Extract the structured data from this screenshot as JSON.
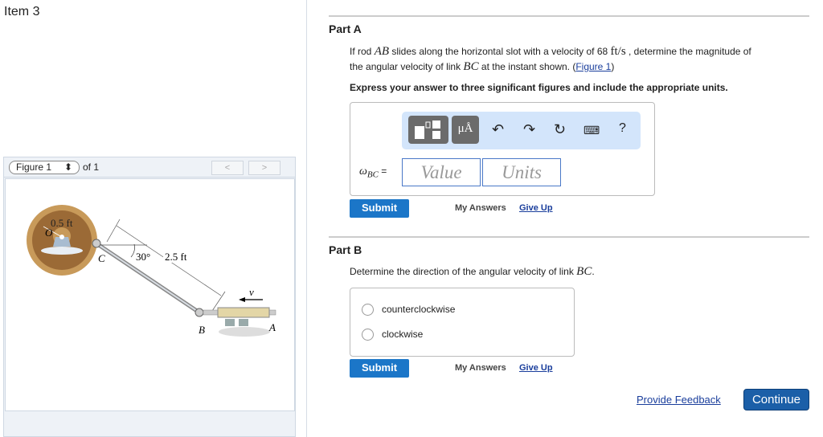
{
  "item_title": "Item 3",
  "figure": {
    "selector": "Figure 1",
    "of": "of 1",
    "prev": "<",
    "next": ">",
    "labels": {
      "radius": "0.5 ft",
      "O": "O",
      "C": "C",
      "angle": "30°",
      "length": "2.5 ft",
      "v": "v",
      "B": "B",
      "A": "A"
    }
  },
  "part_a": {
    "title": "Part A",
    "q1": "If rod ",
    "ab": "AB",
    "q2": " slides along the horizontal slot with a velocity of 68 ",
    "unit": "ft/s",
    "q3": " , determine the magnitude of",
    "q4": "the angular velocity of link ",
    "bc": "BC",
    "q5": " at the instant shown. (",
    "fig_link": "Figure 1",
    "q6": ")",
    "instruction": "Express your answer to three significant figures and include the appropriate units.",
    "toolbar": {
      "units_btn": "μÅ",
      "help": "?"
    },
    "var_label": "ω",
    "var_sub": "BC",
    "eq": " =",
    "value_placeholder": "Value",
    "units_placeholder": "Units",
    "submit": "Submit",
    "my_answers": "My Answers",
    "give_up": "Give Up"
  },
  "part_b": {
    "title": "Part B",
    "q1": "Determine the direction of the angular velocity of link ",
    "bc": "BC",
    "q2": ".",
    "options": [
      "counterclockwise",
      "clockwise"
    ],
    "submit": "Submit",
    "my_answers": "My Answers",
    "give_up": "Give Up"
  },
  "footer": {
    "feedback": "Provide Feedback",
    "continue": "Continue"
  }
}
